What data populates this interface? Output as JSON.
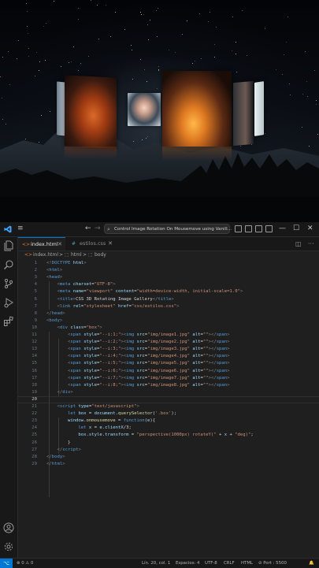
{
  "window": {
    "command_center_text": "Control Image Rotation On Mousemove using Vanill...",
    "back_glyph": "←",
    "forward_glyph": "→",
    "minimize_glyph": "—",
    "maximize_glyph": "☐",
    "close_glyph": "✕"
  },
  "tabs": [
    {
      "label": "index.html",
      "active": true
    },
    {
      "label": "estilos.css",
      "active": false
    }
  ],
  "breadcrumb": [
    "index.html",
    "html",
    "body"
  ],
  "breadcrumb_sep": ">",
  "editor": {
    "current_line": 20,
    "lines": [
      {
        "n": "1",
        "html": "<span class='p'>&lt;!</span><span class='t'>DOCTYPE</span> <span class='a'>html</span><span class='p'>&gt;</span>"
      },
      {
        "n": "2",
        "html": "<span class='p'>&lt;</span><span class='t'>html</span><span class='p'>&gt;</span>"
      },
      {
        "n": "3",
        "html": "<span class='p'>&lt;</span><span class='t'>head</span><span class='p'>&gt;</span>"
      },
      {
        "n": "4",
        "html": "    <span class='p'>&lt;</span><span class='t'>meta</span> <span class='a'>charset</span>=<span class='s'>\"UTF-8\"</span><span class='p'>&gt;</span>"
      },
      {
        "n": "5",
        "html": "    <span class='p'>&lt;</span><span class='t'>meta</span> <span class='a'>name</span>=<span class='s'>\"viewport\"</span> <span class='a'>content</span>=<span class='s'>\"width=device-width, initial-scale=1.0\"</span><span class='p'>&gt;</span>"
      },
      {
        "n": "6",
        "html": "    <span class='p'>&lt;</span><span class='t'>title</span><span class='p'>&gt;</span>CSS 3D Rotating Image Gallery<span class='p'>&lt;/</span><span class='t'>title</span><span class='p'>&gt;</span>"
      },
      {
        "n": "7",
        "html": "    <span class='p'>&lt;</span><span class='t'>link</span> <span class='a'>rel</span>=<span class='s'>\"stylesheet\"</span> <span class='a'>href</span>=<span class='s'>\"css/estilos.css\"</span><span class='p'>&gt;</span>"
      },
      {
        "n": "8",
        "html": "<span class='p'>&lt;/</span><span class='t'>head</span><span class='p'>&gt;</span>"
      },
      {
        "n": "9",
        "html": "<span class='p'>&lt;</span><span class='t'>body</span><span class='p'>&gt;</span>"
      },
      {
        "n": "10",
        "html": "    <span class='p'>&lt;</span><span class='t'>div</span> <span class='a'>class</span>=<span class='s'>\"box\"</span><span class='p'>&gt;</span>"
      },
      {
        "n": "11",
        "html": "        <span class='p'>&lt;</span><span class='t'>span</span> <span class='a'>style</span>=<span class='s'>\"--i:1;\"</span><span class='p'>&gt;&lt;</span><span class='t'>img</span> <span class='a'>src</span>=<span class='s'>\"img/image1.jpg\"</span> <span class='a'>alt</span>=<span class='s'>\"\"</span><span class='p'>&gt;&lt;/</span><span class='t'>span</span><span class='p'>&gt;</span>"
      },
      {
        "n": "12",
        "html": "        <span class='p'>&lt;</span><span class='t'>span</span> <span class='a'>style</span>=<span class='s'>\"--i:2;\"</span><span class='p'>&gt;&lt;</span><span class='t'>img</span> <span class='a'>src</span>=<span class='s'>\"img/image2.jpg\"</span> <span class='a'>alt</span>=<span class='s'>\"\"</span><span class='p'>&gt;&lt;/</span><span class='t'>span</span><span class='p'>&gt;</span>"
      },
      {
        "n": "13",
        "html": "        <span class='p'>&lt;</span><span class='t'>span</span> <span class='a'>style</span>=<span class='s'>\"--i:3;\"</span><span class='p'>&gt;&lt;</span><span class='t'>img</span> <span class='a'>src</span>=<span class='s'>\"img/image3.jpg\"</span> <span class='a'>alt</span>=<span class='s'>\"\"</span><span class='p'>&gt;&lt;/</span><span class='t'>span</span><span class='p'>&gt;</span>"
      },
      {
        "n": "14",
        "html": "        <span class='p'>&lt;</span><span class='t'>span</span> <span class='a'>style</span>=<span class='s'>\"--i:4;\"</span><span class='p'>&gt;&lt;</span><span class='t'>img</span> <span class='a'>src</span>=<span class='s'>\"img/image4.jpg\"</span> <span class='a'>alt</span>=<span class='s'>\"\"</span><span class='p'>&gt;&lt;/</span><span class='t'>span</span><span class='p'>&gt;</span>"
      },
      {
        "n": "15",
        "html": "        <span class='p'>&lt;</span><span class='t'>span</span> <span class='a'>style</span>=<span class='s'>\"--i:5;\"</span><span class='p'>&gt;&lt;</span><span class='t'>img</span> <span class='a'>src</span>=<span class='s'>\"img/image5.jpg\"</span> <span class='a'>alt</span>=<span class='s'>\"\"</span><span class='p'>&gt;&lt;/</span><span class='t'>span</span><span class='p'>&gt;</span>"
      },
      {
        "n": "16",
        "html": "        <span class='p'>&lt;</span><span class='t'>span</span> <span class='a'>style</span>=<span class='s'>\"--i:6;\"</span><span class='p'>&gt;&lt;</span><span class='t'>img</span> <span class='a'>src</span>=<span class='s'>\"img/image6.jpg\"</span> <span class='a'>alt</span>=<span class='s'>\"\"</span><span class='p'>&gt;&lt;/</span><span class='t'>span</span><span class='p'>&gt;</span>"
      },
      {
        "n": "17",
        "html": "        <span class='p'>&lt;</span><span class='t'>span</span> <span class='a'>style</span>=<span class='s'>\"--i:7;\"</span><span class='p'>&gt;&lt;</span><span class='t'>img</span> <span class='a'>src</span>=<span class='s'>\"img/image7.jpg\"</span> <span class='a'>alt</span>=<span class='s'>\"\"</span><span class='p'>&gt;&lt;/</span><span class='t'>span</span><span class='p'>&gt;</span>"
      },
      {
        "n": "18",
        "html": "        <span class='p'>&lt;</span><span class='t'>span</span> <span class='a'>style</span>=<span class='s'>\"--i:8;\"</span><span class='p'>&gt;&lt;</span><span class='t'>img</span> <span class='a'>src</span>=<span class='s'>\"img/image8.jpg\"</span> <span class='a'>alt</span>=<span class='s'>\"\"</span><span class='p'>&gt;&lt;/</span><span class='t'>span</span><span class='p'>&gt;</span>"
      },
      {
        "n": "19",
        "html": "    <span class='p'>&lt;/</span><span class='t'>div</span><span class='p'>&gt;</span>"
      },
      {
        "n": "20",
        "html": ""
      },
      {
        "n": "21",
        "html": "    <span class='p'>&lt;</span><span class='t'>script</span> <span class='a'>type</span>=<span class='s'>\"text/javascript\"</span><span class='p'>&gt;</span>"
      },
      {
        "n": "22",
        "html": "        <span class='k'>let</span> <span class='v'>box</span> = <span class='v'>document</span>.<span class='f'>querySelector</span>(<span class='s'>'.box'</span>);"
      },
      {
        "n": "23",
        "html": "        <span class='v'>window</span>.<span class='f'>onmousemove</span> = <span class='k'>function</span>(<span class='v'>e</span>){"
      },
      {
        "n": "24",
        "html": "            <span class='k'>let</span> <span class='v'>x</span> = <span class='v'>e</span>.<span class='v'>clientX</span>/3;"
      },
      {
        "n": "25",
        "html": "            <span class='v'>box</span>.<span class='v'>style</span>.<span class='v'>transform</span> = <span class='s'>\"perspective(1000px) rotateY(\"</span> + <span class='v'>x</span> + <span class='s'>\"deg)\"</span>;"
      },
      {
        "n": "26",
        "html": "        }"
      },
      {
        "n": "27",
        "html": "    <span class='p'>&lt;/</span><span class='t'>script</span><span class='p'>&gt;</span>"
      },
      {
        "n": "28",
        "html": "<span class='p'>&lt;/</span><span class='t'>body</span><span class='p'>&gt;</span>"
      },
      {
        "n": "29",
        "html": "<span class='p'>&lt;/</span><span class='t'>html</span><span class='p'>&gt;</span>"
      }
    ]
  },
  "statusbar": {
    "remote_glyph": "⌥",
    "problems": "⊗ 0 ⚠ 0",
    "cursor": "Lín. 20, col. 1",
    "spaces": "Espacios: 4",
    "encoding": "UTF-8",
    "eol": "CRLF",
    "language": "HTML",
    "port": "⊘ Port : 5500",
    "notifications_glyph": "🔔"
  },
  "colors": {
    "accent": "#0078d4",
    "editor_bg": "#1f1f1f",
    "tag": "#569cd6",
    "attr": "#9cdcfe",
    "string": "#ce9178"
  },
  "icons": [
    "explorer-icon",
    "search-icon",
    "source-control-icon",
    "run-debug-icon",
    "extensions-icon",
    "account-icon",
    "settings-gear-icon",
    "vscode-logo-icon",
    "menu-icon",
    "split-editor-icon",
    "more-actions-icon"
  ]
}
